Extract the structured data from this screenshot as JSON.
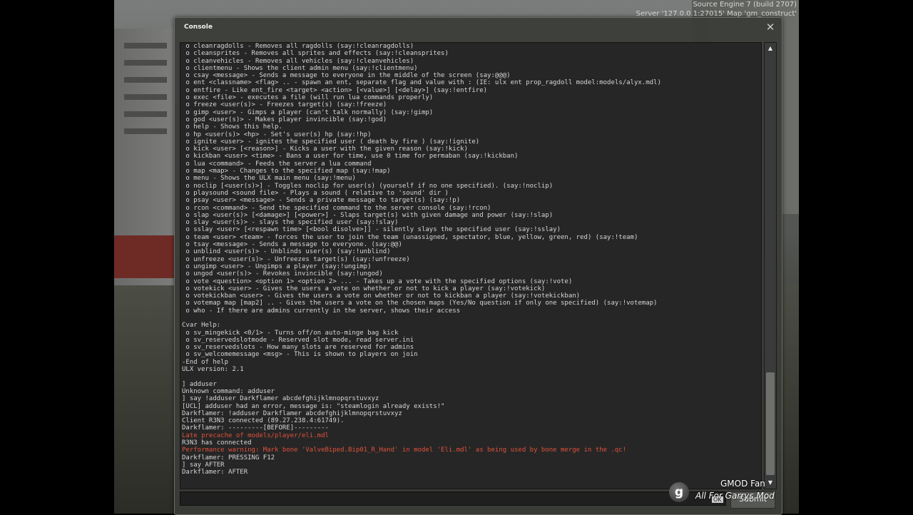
{
  "engine_info": {
    "line1": "Source Engine 7 (build 2707)",
    "line2": "Server '127.0.0.1:27015' Map 'gm_construct'"
  },
  "console": {
    "title": "Console",
    "close_icon": "close-icon",
    "submit_label": "Submit",
    "input_value": "",
    "lines": [
      {
        "text": " o cleanragdolls - Removes all ragdolls (say:!cleanragdolls)",
        "warn": false
      },
      {
        "text": " o cleansprites - Removes all sprites and effects (say:!cleansprites)",
        "warn": false
      },
      {
        "text": " o cleanvehicles - Removes all vehicles (say:!cleanvehicles)",
        "warn": false
      },
      {
        "text": " o clientmenu - Shows the client admin menu (say:!clientmenu)",
        "warn": false
      },
      {
        "text": " o csay <message> - Sends a message to everyone in the middle of the screen (say:@@@)",
        "warn": false
      },
      {
        "text": " o ent <classname> <flag> .. - spawn an ent, separate flag and value with : (IE: ulx ent prop_ragdoll model:models/alyx.mdl)",
        "warn": false
      },
      {
        "text": " o entfire - Like ent_fire <target> <action> [<value>] [<delay>] (say:!entfire)",
        "warn": false
      },
      {
        "text": " o exec <file> - executes a file (will run lua commands properly)",
        "warn": false
      },
      {
        "text": " o freeze <user(s)> - Freezes target(s) (say:!freeze)",
        "warn": false
      },
      {
        "text": " o gimp <user> - Gimps a player (can't talk normally) (say:!gimp)",
        "warn": false
      },
      {
        "text": " o god <user(s)> - Makes player invincible (say:!god)",
        "warn": false
      },
      {
        "text": " o help - Shows this help.",
        "warn": false
      },
      {
        "text": " o hp <user(s)> <hp> - Set's user(s) hp (say:!hp)",
        "warn": false
      },
      {
        "text": " o ignite <user> - ignites the specified user ( death by fire ) (say:!ignite)",
        "warn": false
      },
      {
        "text": " o kick <user> [<reason>] - Kicks a user with the given reason (say:!kick)",
        "warn": false
      },
      {
        "text": " o kickban <user> <time> - Bans a user for time, use 0 time for permaban (say:!kickban)",
        "warn": false
      },
      {
        "text": " o lua <command> - Feeds the server a lua command",
        "warn": false
      },
      {
        "text": " o map <map> - Changes to the specified map (say:!map)",
        "warn": false
      },
      {
        "text": " o menu - Shows the ULX main menu (say:!menu)",
        "warn": false
      },
      {
        "text": " o noclip [<user(s)>] - Toggles noclip for user(s) (yourself if no one specified). (say:!noclip)",
        "warn": false
      },
      {
        "text": " o playsound <sound file> - Plays a sound ( relative to 'sound' dir )",
        "warn": false
      },
      {
        "text": " o psay <user> <message> - Sends a private message to target(s) (say:!p)",
        "warn": false
      },
      {
        "text": " o rcon <command> - Send the specified command to the server console (say:!rcon)",
        "warn": false
      },
      {
        "text": " o slap <user(s)> [<damage>] [<power>] - Slaps target(s) with given damage and power (say:!slap)",
        "warn": false
      },
      {
        "text": " o slay <user(s)> - slays the specified user (say:!slay)",
        "warn": false
      },
      {
        "text": " o sslay <user> [<respawn time> [<bool disolve>]] - silently slays the specified user (say:!sslay)",
        "warn": false
      },
      {
        "text": " o team <user> <team> - forces the user to join the team (unassigned, spectator, blue, yellow, green, red) (say:!team)",
        "warn": false
      },
      {
        "text": " o tsay <message> - Sends a message to everyone. (say:@@)",
        "warn": false
      },
      {
        "text": " o unblind <user(s)> - Unblinds user(s) (say:!unblind)",
        "warn": false
      },
      {
        "text": " o unfreeze <user(s)> - Unfreezes target(s) (say:!unfreeze)",
        "warn": false
      },
      {
        "text": " o ungimp <user> - Ungimps a player (say:!ungimp)",
        "warn": false
      },
      {
        "text": " o ungod <user(s)> - Revokes invincible (say:!ungod)",
        "warn": false
      },
      {
        "text": " o vote <question> <option 1> <option 2> ... - Takes up a vote with the specified options (say:!vote)",
        "warn": false
      },
      {
        "text": " o votekick <user> - Gives the users a vote on whether or not to kick a player (say:!votekick)",
        "warn": false
      },
      {
        "text": " o votekickban <user> - Gives the users a vote on whether or not to kickban a player (say:!votekickban)",
        "warn": false
      },
      {
        "text": " o votemap map [map2] .. - Gives the users a vote on the chosen maps (Yes/No question if only one specified) (say:!votemap)",
        "warn": false
      },
      {
        "text": " o who - If there are admins currently in the server, shows their access",
        "warn": false
      },
      {
        "text": "",
        "warn": false
      },
      {
        "text": "Cvar Help:",
        "warn": false
      },
      {
        "text": " o sv_mingekick <0/1> - Turns off/on auto-minge bag kick",
        "warn": false
      },
      {
        "text": " o sv_reservedslotmode - Reserved slot mode, read server.ini",
        "warn": false
      },
      {
        "text": " o sv_reservedslots - How many slots are reserved for admins",
        "warn": false
      },
      {
        "text": " o sv_welcomemessage <msg> - This is shown to players on join",
        "warn": false
      },
      {
        "text": "-End of help",
        "warn": false
      },
      {
        "text": "ULX version: 2.1",
        "warn": false
      },
      {
        "text": "",
        "warn": false
      },
      {
        "text": "] adduser",
        "warn": false
      },
      {
        "text": "Unknown command: adduser",
        "warn": false
      },
      {
        "text": "] say !adduser Darkflamer abcdefghijklmnopqrstuvxyz",
        "warn": false
      },
      {
        "text": "[UCL] adduser had an error, message is: \"steamlogin already exists!\"",
        "warn": false
      },
      {
        "text": "Darkflamer: !adduser Darkflamer abcdefghijklmnopqrstuvxyz",
        "warn": false
      },
      {
        "text": "Client R3N3 connected (89.27.238.4:61749).",
        "warn": false
      },
      {
        "text": "Darkflamer: ---------[BEFORE]---------",
        "warn": false
      },
      {
        "text": "Late precache of models/player/eli.mdl",
        "warn": true
      },
      {
        "text": "R3N3 has connected",
        "warn": false
      },
      {
        "text": "Performance warning: Mark bone 'ValveBiped.Bip01_R_Hand' in model 'Eli.mdl' as being used by bone merge in the .qc!",
        "warn": true
      },
      {
        "text": "Darkflamer: PRESSING F12",
        "warn": false
      },
      {
        "text": "] say AFTER",
        "warn": false
      },
      {
        "text": "Darkflamer: AFTER",
        "warn": false
      }
    ]
  },
  "overlay": {
    "fan_text": "GMOD Fan",
    "mod_text": "All For Garrys Mod",
    "logo_letter": "g",
    "ok_text": "OK"
  }
}
